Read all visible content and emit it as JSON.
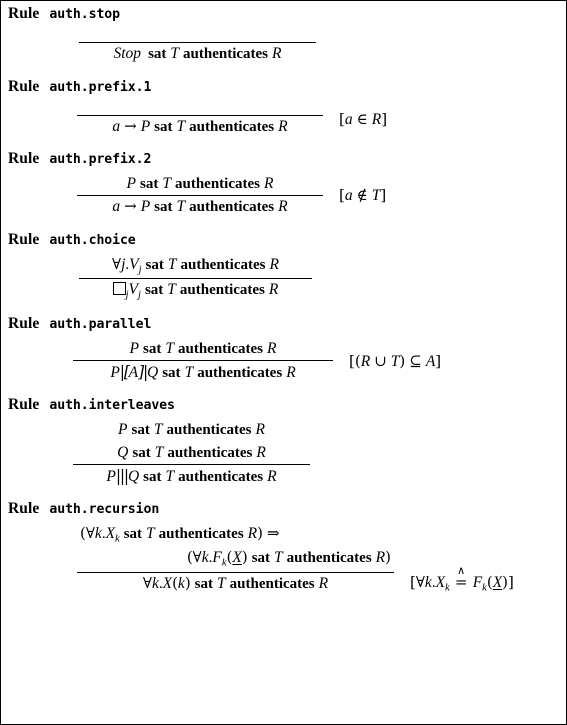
{
  "document": {
    "kind": "inference-rule-list",
    "rule_keyword": "Rule",
    "border_color": "#000000",
    "background_color": "#ffffff",
    "text_color": "#000000"
  },
  "rules": [
    {
      "id": "auth-stop",
      "name": "auth.stop",
      "premises": [],
      "conclusion": "Stop sat T authenticates R",
      "side_condition": ""
    },
    {
      "id": "auth-prefix-1",
      "name": "auth.prefix.1",
      "premises": [],
      "conclusion": "a → P sat T authenticates R",
      "side_condition": "[a ∈ R]"
    },
    {
      "id": "auth-prefix-2",
      "name": "auth.prefix.2",
      "premises": [
        "P sat T authenticates R"
      ],
      "conclusion": "a → P sat T authenticates R",
      "side_condition": "[a ∉ T]"
    },
    {
      "id": "auth-choice",
      "name": "auth.choice",
      "premises": [
        "∀j.Vj sat T authenticates R"
      ],
      "conclusion": "□j Vj sat T authenticates R",
      "side_condition": ""
    },
    {
      "id": "auth-parallel",
      "name": "auth.parallel",
      "premises": [
        "P sat T authenticates R"
      ],
      "conclusion": "P|[A]|Q sat T authenticates R",
      "side_condition": "[(R ∪ T) ⊆ A]"
    },
    {
      "id": "auth-interleaves",
      "name": "auth.interleaves",
      "premises": [
        "P sat T authenticates R",
        "Q sat T authenticates R"
      ],
      "conclusion": "P|||Q sat T authenticates R",
      "side_condition": ""
    },
    {
      "id": "auth-recursion",
      "name": "auth.recursion",
      "premises": [
        "(∀k.Xk sat T authenticates R) ⇒",
        "(∀k.Fk(X) sat T authenticates R)"
      ],
      "conclusion": "∀k.X(k) sat T authenticates R",
      "side_condition": "[∀k.Xk ≜ Fk(X)]"
    }
  ],
  "glossary": {
    "sat": "sat",
    "authenticates": "authenticates",
    "stop": "Stop",
    "var_T": "T",
    "var_R": "R",
    "var_P": "P",
    "var_Q": "Q",
    "var_A": "A",
    "var_a": "a",
    "var_V": "V",
    "var_X": "X",
    "var_F": "F",
    "var_j": "j",
    "var_k": "k",
    "arrow_prefix": "→",
    "implies": "⇒",
    "forall": "∀",
    "in": "∈",
    "notin": "∉",
    "union": "∪",
    "subseteq": "⊆",
    "defined_as": "≜",
    "box_choice": "□",
    "bracket_open": "[",
    "bracket_close": "]",
    "paren_open": "(",
    "paren_close": ")",
    "dot": ".",
    "interleave": "|||",
    "parallel_open": "|[",
    "parallel_close": "]|"
  }
}
